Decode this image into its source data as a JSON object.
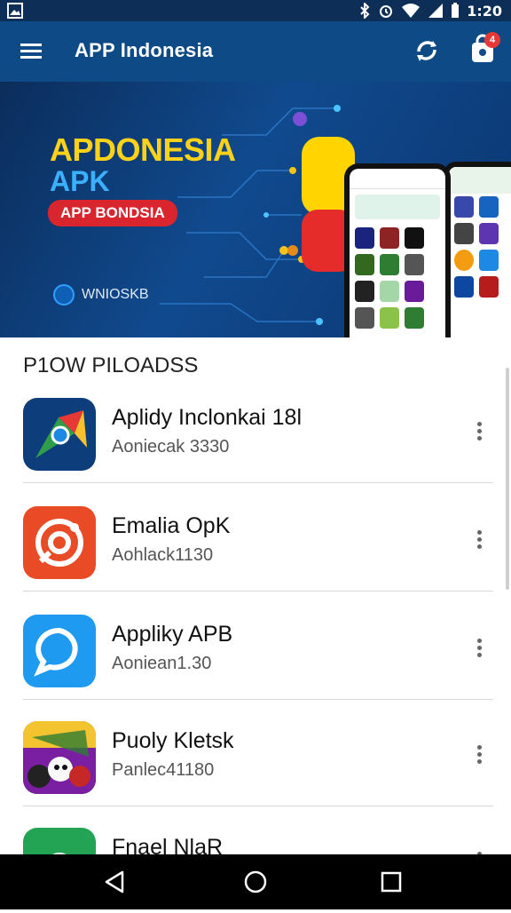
{
  "status_bar": {
    "time": "1:20",
    "icons": [
      "gallery-icon",
      "bluetooth-icon",
      "alarm-icon",
      "wifi-icon",
      "signal-icon",
      "battery-icon"
    ]
  },
  "app_bar": {
    "title": "APP Indonesia",
    "badge_count": "4",
    "icons": [
      "menu-icon",
      "sync-icon",
      "shopping-bag-icon"
    ]
  },
  "banner": {
    "headline_1": "APDONESIA",
    "headline_2": "APK",
    "pill_text": "APP BONDSIA",
    "brand_text": "WNIOSKB",
    "colors": {
      "headline_1": "#ffd21a",
      "headline_2": "#3bb0ff",
      "pill": "#d8252e",
      "background": "#0e4a86"
    }
  },
  "section": {
    "title": "P1OW PILOADSS"
  },
  "apps": [
    {
      "name": "Aplidy Inclonkai 18l",
      "subtitle": "Aoniecak 3330",
      "icon": "chrome-like-icon"
    },
    {
      "name": "Emalia OpK",
      "subtitle": "Aohlack1130",
      "icon": "camera-target-icon"
    },
    {
      "name": "Appliky APB",
      "subtitle": "Aoniean1.30",
      "icon": "chat-bubble-icon"
    },
    {
      "name": "Puoly Kletsk",
      "subtitle": "Panlec41180",
      "icon": "game-characters-icon"
    },
    {
      "name": "Fnael NlaR",
      "subtitle": "",
      "icon": "green-cloud-icon"
    }
  ],
  "nav_bar": {
    "icons": [
      "back-icon",
      "home-icon",
      "recents-icon"
    ]
  }
}
